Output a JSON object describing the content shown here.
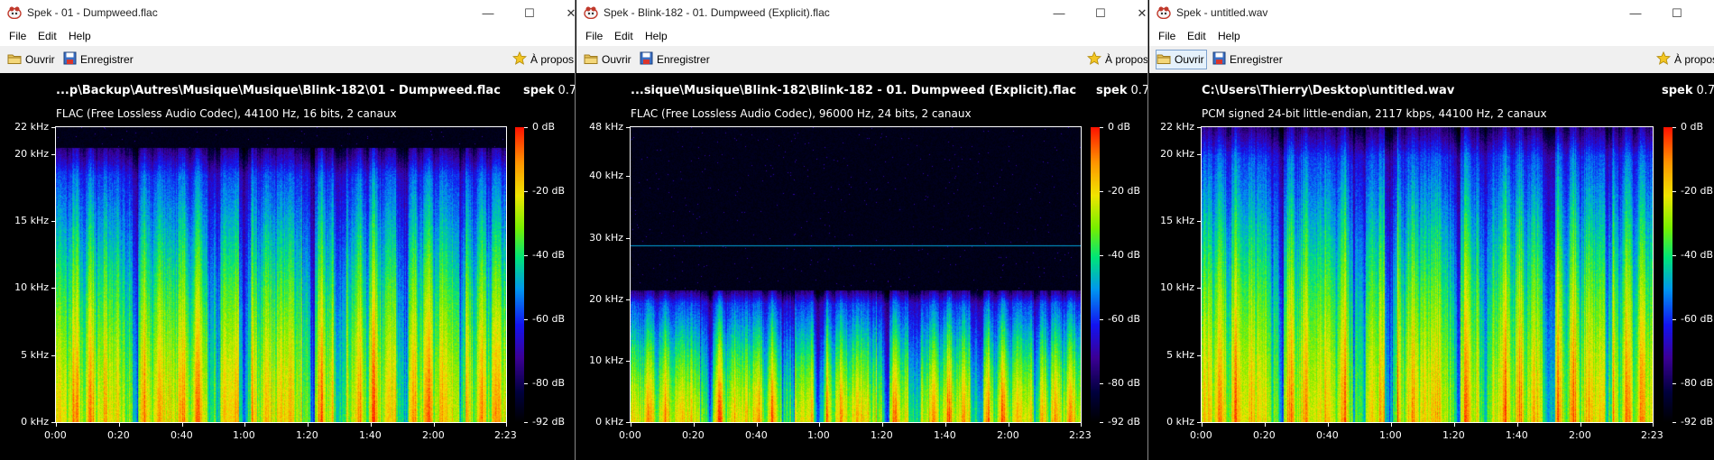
{
  "windows": [
    {
      "title": "Spek - 01 - Dumpweed.flac",
      "menu": [
        "File",
        "Edit",
        "Help"
      ],
      "toolbar": {
        "open": "Ouvrir",
        "save": "Enregistrer",
        "about": "À propos"
      },
      "file_path": "...p\\Backup\\Autres\\Musique\\Musique\\Blink-182\\01 - Dumpweed.flac",
      "codec_info": "FLAC (Free Lossless Audio Codec), 44100 Hz, 16 bits, 2 canaux",
      "brand": "spek",
      "version": "0.7",
      "freq_ticks": [
        "22 kHz",
        "20 kHz",
        "15 kHz",
        "10 kHz",
        "5 kHz",
        "0 kHz"
      ],
      "time_ticks": [
        "0:00",
        "0:20",
        "0:40",
        "1:00",
        "1:20",
        "1:40",
        "2:00",
        "2:23"
      ],
      "db_ticks": [
        "0 dB",
        "-20 dB",
        "-40 dB",
        "-60 dB",
        "-80 dB",
        "-92 dB"
      ],
      "spectrum": {
        "sample_rate_khz": 44.1,
        "max_freq_khz": 22,
        "cutoff_khz": 20.5,
        "duration_s": 143,
        "line_khz": null
      }
    },
    {
      "title": "Spek - Blink-182 - 01. Dumpweed (Explicit).flac",
      "menu": [
        "File",
        "Edit",
        "Help"
      ],
      "toolbar": {
        "open": "Ouvrir",
        "save": "Enregistrer",
        "about": "À propos"
      },
      "file_path": "...sique\\Musique\\Blink-182\\Blink-182 - 01. Dumpweed (Explicit).flac",
      "codec_info": "FLAC (Free Lossless Audio Codec), 96000 Hz, 24 bits, 2 canaux",
      "brand": "spek",
      "version": "0.7",
      "freq_ticks": [
        "48 kHz",
        "40 kHz",
        "30 kHz",
        "20 kHz",
        "10 kHz",
        "0 kHz"
      ],
      "time_ticks": [
        "0:00",
        "0:20",
        "0:40",
        "1:00",
        "1:20",
        "1:40",
        "2:00",
        "2:23"
      ],
      "db_ticks": [
        "0 dB",
        "-20 dB",
        "-40 dB",
        "-60 dB",
        "-80 dB",
        "-92 dB"
      ],
      "spectrum": {
        "sample_rate_khz": 96,
        "max_freq_khz": 48,
        "cutoff_khz": 21.5,
        "duration_s": 143,
        "line_khz": 28.8
      }
    },
    {
      "title": "Spek - untitled.wav",
      "menu": [
        "File",
        "Edit",
        "Help"
      ],
      "toolbar": {
        "open": "Ouvrir",
        "save": "Enregistrer",
        "about": "À propos"
      },
      "file_path": "C:\\Users\\Thierry\\Desktop\\untitled.wav",
      "codec_info": "PCM signed 24-bit little-endian, 2117 kbps, 44100 Hz, 2 canaux",
      "brand": "spek",
      "version": "0.7",
      "freq_ticks": [
        "22 kHz",
        "20 kHz",
        "15 kHz",
        "10 kHz",
        "5 kHz",
        "0 kHz"
      ],
      "time_ticks": [
        "0:00",
        "0:20",
        "0:40",
        "1:00",
        "1:20",
        "1:40",
        "2:00",
        "2:23"
      ],
      "db_ticks": [
        "0 dB",
        "-20 dB",
        "-40 dB",
        "-60 dB",
        "-80 dB",
        "-92 dB"
      ],
      "spectrum": {
        "sample_rate_khz": 44.1,
        "max_freq_khz": 22,
        "cutoff_khz": 22,
        "duration_s": 143,
        "line_khz": null
      }
    }
  ],
  "colors": {
    "background": "#000000",
    "title_bg": "#ffffff",
    "toolbar_bg": "#f0f0f0",
    "text_on_dark": "#ffffff"
  }
}
